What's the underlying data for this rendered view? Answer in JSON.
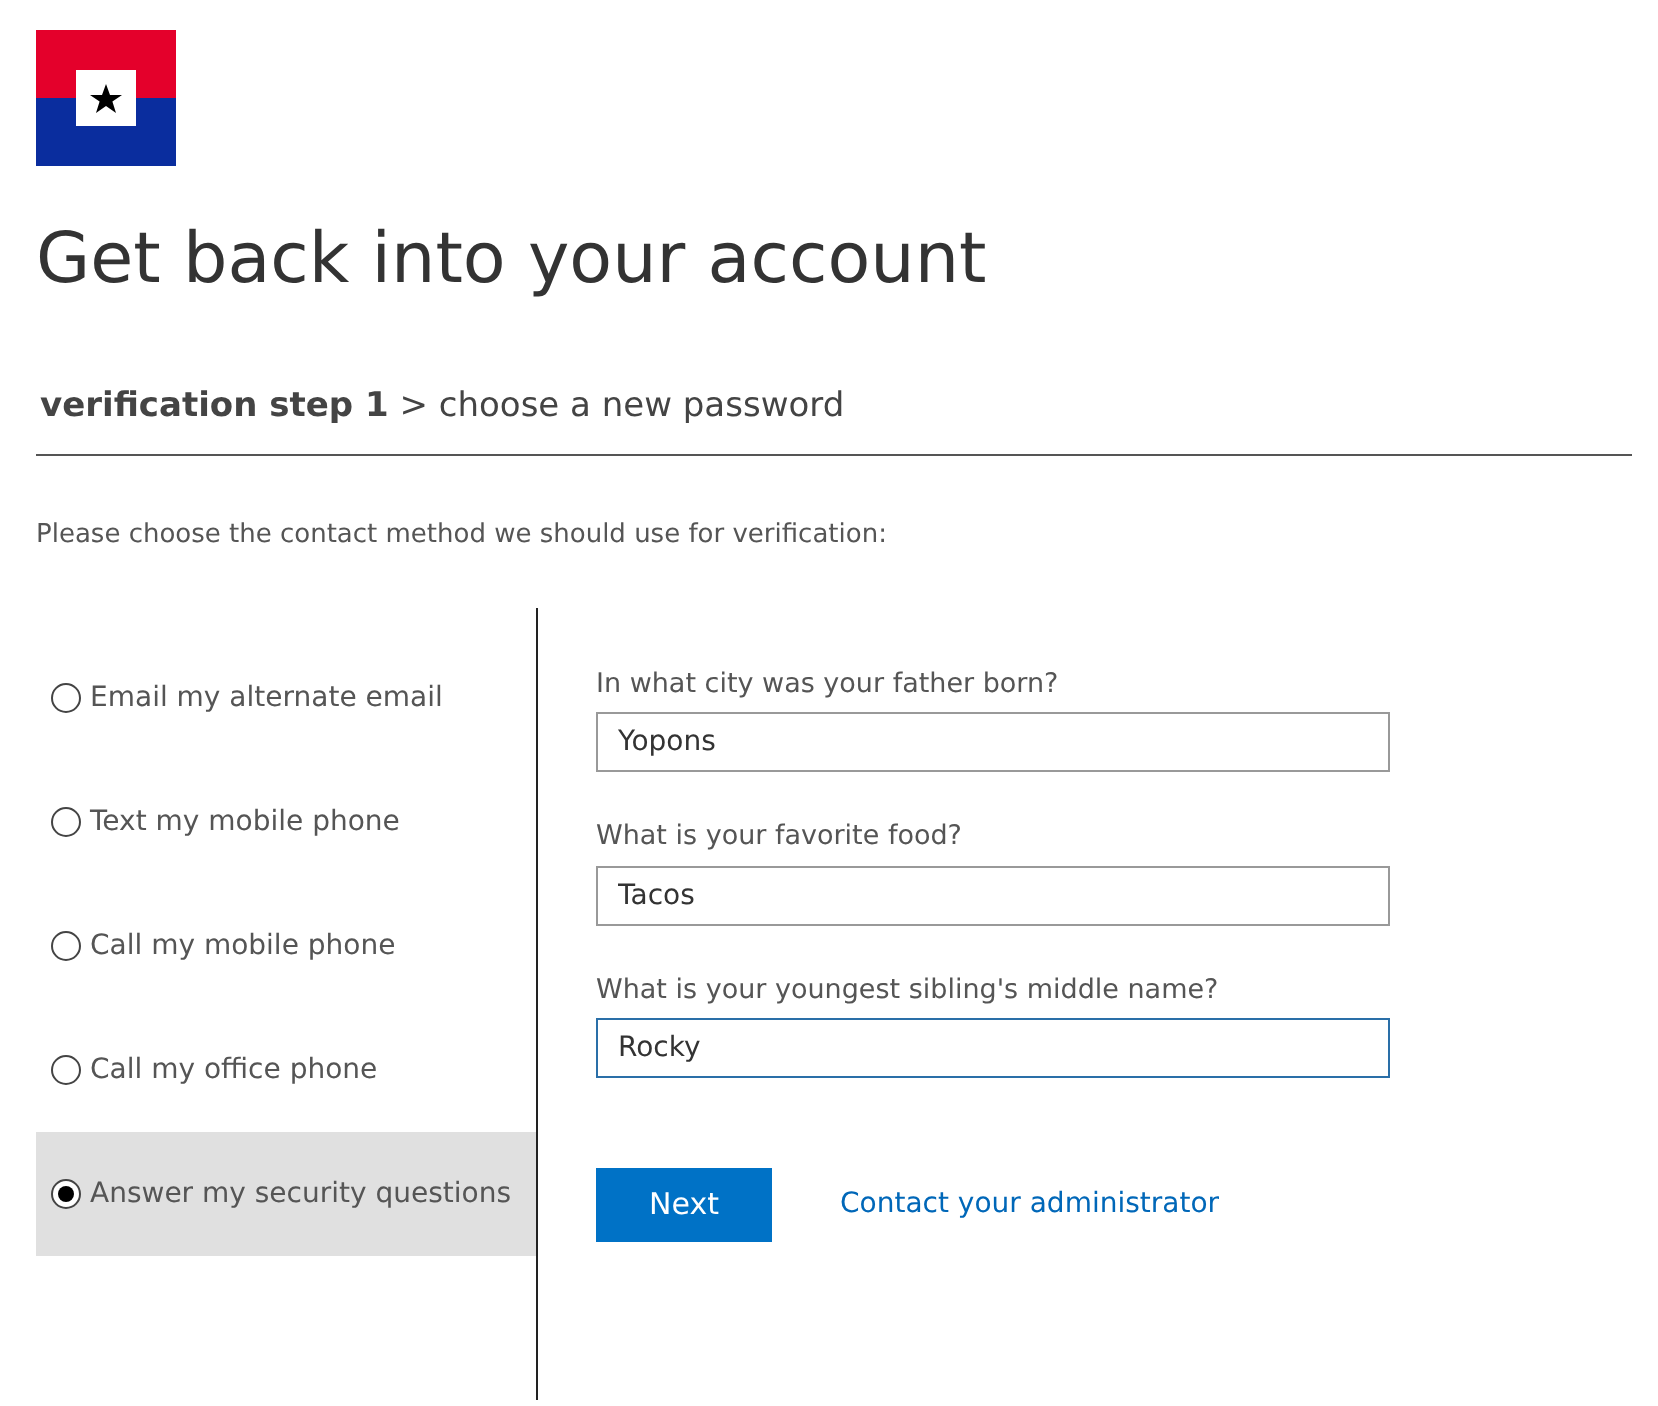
{
  "title": "Get back into your account",
  "steps": [
    {
      "label": "verification step 1",
      "selected": true
    },
    {
      "label": "choose a new password",
      "selected": false
    }
  ],
  "separator": ">",
  "instruction": "Please choose the contact method we should use for verification:",
  "methods": [
    {
      "label": "Email my alternate email",
      "selected": false
    },
    {
      "label": "Text my mobile phone",
      "selected": false
    },
    {
      "label": "Call my mobile phone",
      "selected": false
    },
    {
      "label": "Call my office phone",
      "selected": false
    },
    {
      "label": "Answer my security questions",
      "selected": true
    }
  ],
  "questions": [
    {
      "label": "In what city was your father born?",
      "value": "Yopons",
      "focused": false
    },
    {
      "label": "What is your favorite food?",
      "value": "Tacos",
      "focused": false
    },
    {
      "label": "What is your youngest sibling's middle name?",
      "value": "Rocky",
      "focused": true
    }
  ],
  "next_button": "Next",
  "contact_link": "Contact your administrator"
}
